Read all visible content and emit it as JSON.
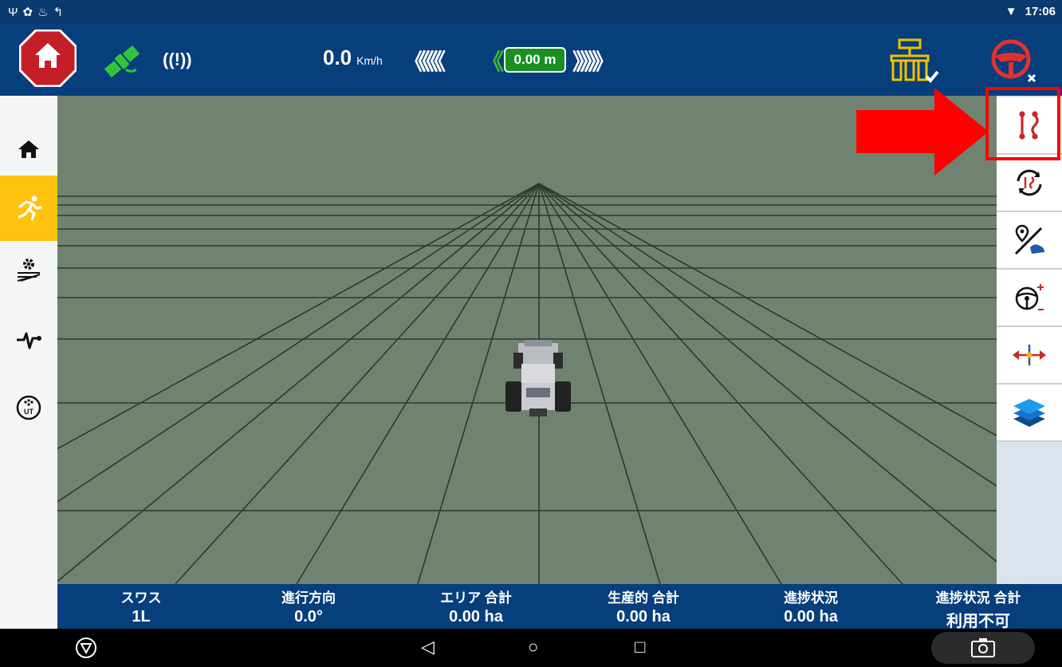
{
  "status_bar": {
    "icons": [
      "usb-icon",
      "notification-icon",
      "water-icon",
      "sync-icon"
    ],
    "wifi_icon": "wifi-icon",
    "time": "17:06"
  },
  "top_bar": {
    "home_icon": "home-stop-icon",
    "gps_icon": "satellite-icon",
    "signal_text": "((!))",
    "speed_value": "0.0",
    "speed_unit": "Km/h",
    "offset_value": "0.00 m",
    "implement_icon": "implement-icon",
    "steering_icon": "steering-wheel-off-icon"
  },
  "left_nav": [
    {
      "icon": "home-icon",
      "active": false
    },
    {
      "icon": "run-icon",
      "active": true
    },
    {
      "icon": "field-settings-icon",
      "active": false
    },
    {
      "icon": "diagnostics-icon",
      "active": false
    },
    {
      "icon": "ut-icon",
      "active": false
    }
  ],
  "right_tools": [
    {
      "icon": "guidance-lines-icon",
      "highlighted": true
    },
    {
      "icon": "guidance-cycle-icon"
    },
    {
      "icon": "map-marker-boundary-icon"
    },
    {
      "icon": "steering-adjust-icon"
    },
    {
      "icon": "nudge-icon"
    },
    {
      "icon": "layers-icon"
    }
  ],
  "stats": [
    {
      "label": "スワス",
      "value": "1L"
    },
    {
      "label": "進行方向",
      "value": "0.0°"
    },
    {
      "label": "エリア 合計",
      "value": "0.00 ha"
    },
    {
      "label": "生産的 合計",
      "value": "0.00 ha"
    },
    {
      "label": "進捗状況",
      "value": "0.00 ha"
    },
    {
      "label": "進捗状況 合計",
      "value": "利用不可"
    }
  ],
  "nav_bar": {
    "back_label": "◁",
    "home_label": "○",
    "recents_label": "□"
  },
  "colors": {
    "header": "#063f7c",
    "field": "#6f8370",
    "accent": "#ffc20e",
    "highlight": "#ff0000"
  }
}
